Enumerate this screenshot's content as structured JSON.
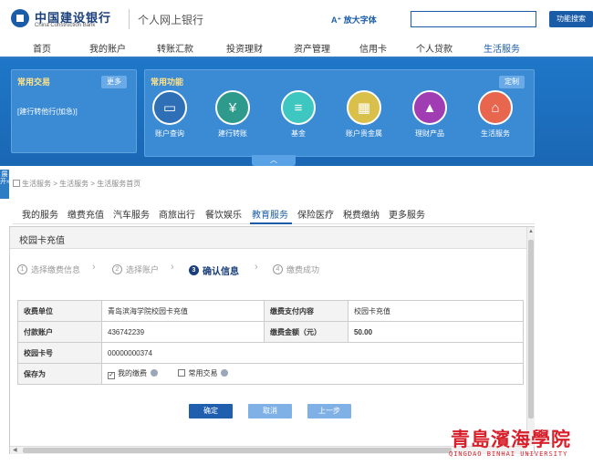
{
  "header": {
    "bank_name_cn": "中国建设银行",
    "bank_name_en": "China Construction Bank",
    "site_title": "个人网上银行",
    "bigfont_label": "A⁺ 放大字体",
    "search_placeholder": "",
    "search_button": "功能搜索"
  },
  "nav": [
    "首页",
    "我的账户",
    "转账汇款",
    "投资理财",
    "资产管理",
    "信用卡",
    "个人贷款",
    "生活服务"
  ],
  "nav_active": "生活服务",
  "quick": {
    "title": "常用交易",
    "more_button": "更多",
    "link": "[建行转他行(加急)]"
  },
  "functions": {
    "title": "常用功能",
    "custom_button": "定制",
    "items": [
      {
        "label": "账户查询",
        "icon": "account-query-icon",
        "glyph": "▭",
        "color": "#2f6fb5"
      },
      {
        "label": "建行转账",
        "icon": "transfer-icon",
        "glyph": "¥",
        "color": "#2d9a8c"
      },
      {
        "label": "基金",
        "icon": "fund-icon",
        "glyph": "≡",
        "color": "#3ec6c0"
      },
      {
        "label": "账户贵金属",
        "icon": "gold-icon",
        "glyph": "▦",
        "color": "#d9c04a"
      },
      {
        "label": "理财产品",
        "icon": "wealth-icon",
        "glyph": "▲",
        "color": "#a13db3"
      },
      {
        "label": "生活服务",
        "icon": "life-service-icon",
        "glyph": "⌂",
        "color": "#e8664d"
      }
    ]
  },
  "side_handle": "展开»",
  "breadcrumb": "生活服务 > 生活服务 > 生活服务首页",
  "service_tabs": [
    "我的服务",
    "缴费充值",
    "汽车服务",
    "商旅出行",
    "餐饮娱乐",
    "教育服务",
    "保险医疗",
    "税费缴纳",
    "更多服务"
  ],
  "service_tab_active": "教育服务",
  "panel_title": "校园卡充值",
  "steps": [
    {
      "num": "1",
      "label": "选择缴费信息"
    },
    {
      "num": "2",
      "label": "选择账户"
    },
    {
      "num": "3",
      "label": "确认信息"
    },
    {
      "num": "4",
      "label": "缴费成功"
    }
  ],
  "step_active": 3,
  "table": {
    "payee_label": "收费单位",
    "payee_value": "青岛滨海学院校园卡充值",
    "content_label": "缴费支付内容",
    "content_value": "校园卡充值",
    "account_label": "付款账户",
    "account_value": "436742239",
    "amount_label": "缴费金额（元）",
    "amount_value": "50.00",
    "card_label": "校园卡号",
    "card_value": "00000000374",
    "save_label": "保存为",
    "save_opt1": "我的缴费",
    "save_opt1_checked": "✓",
    "save_opt2": "常用交易"
  },
  "buttons": {
    "confirm": "确定",
    "cancel": "取消",
    "prev": "上一步"
  },
  "watermark": {
    "cn": "青島濱海學院",
    "en": "QINGDAO BINHAI UNIVERSITY"
  }
}
